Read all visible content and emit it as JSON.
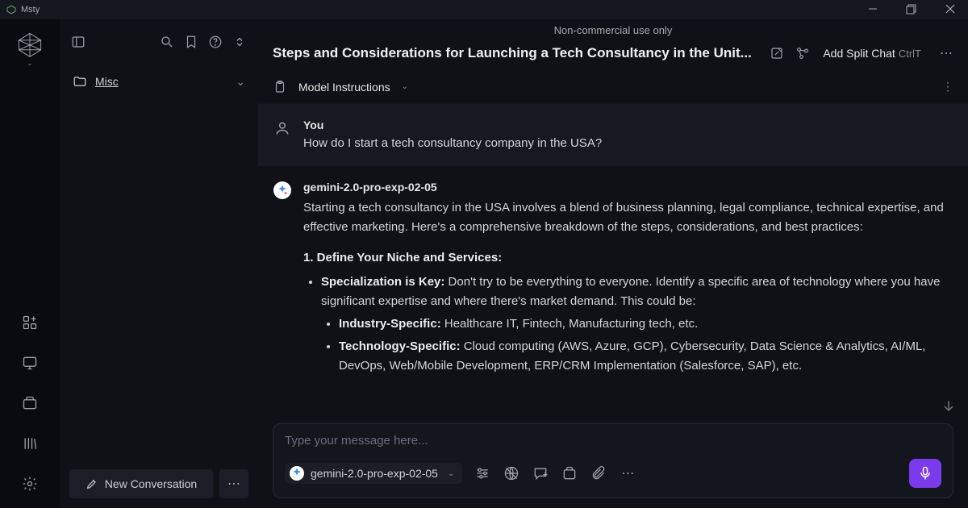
{
  "app": {
    "name": "Msty",
    "notice": "Non-commercial use only"
  },
  "header": {
    "title": "Steps and Considerations for Launching a Tech Consultancy in the Unit...",
    "add_split_label": "Add Split Chat",
    "add_split_shortcut": "CtrlT"
  },
  "model_instructions": {
    "label": "Model Instructions"
  },
  "sidebar": {
    "folder": "Misc",
    "new_conversation": "New Conversation"
  },
  "conversation": {
    "user_label": "You",
    "user_message": "How do I start a tech consultancy company in the USA?",
    "ai_model": "gemini-2.0-pro-exp-02-05",
    "ai_intro": "Starting a tech consultancy in the USA involves a blend of business planning, legal compliance, technical expertise, and effective marketing. Here's a comprehensive breakdown of the steps, considerations, and best practices:",
    "section1_head": "1. Define Your Niche and Services:",
    "bullet1_bold": "Specialization is Key:",
    "bullet1_text": " Don't try to be everything to everyone. Identify a specific area of technology where you have significant expertise and where there's market demand. This could be:",
    "sub1_bold": "Industry-Specific:",
    "sub1_text": " Healthcare IT, Fintech, Manufacturing tech, etc.",
    "sub2_bold": "Technology-Specific:",
    "sub2_text": " Cloud computing (AWS, Azure, GCP), Cybersecurity, Data Science & Analytics, AI/ML, DevOps, Web/Mobile Development, ERP/CRM Implementation (Salesforce, SAP), etc."
  },
  "composer": {
    "placeholder": "Type your message here...",
    "model": "gemini-2.0-pro-exp-02-05"
  }
}
